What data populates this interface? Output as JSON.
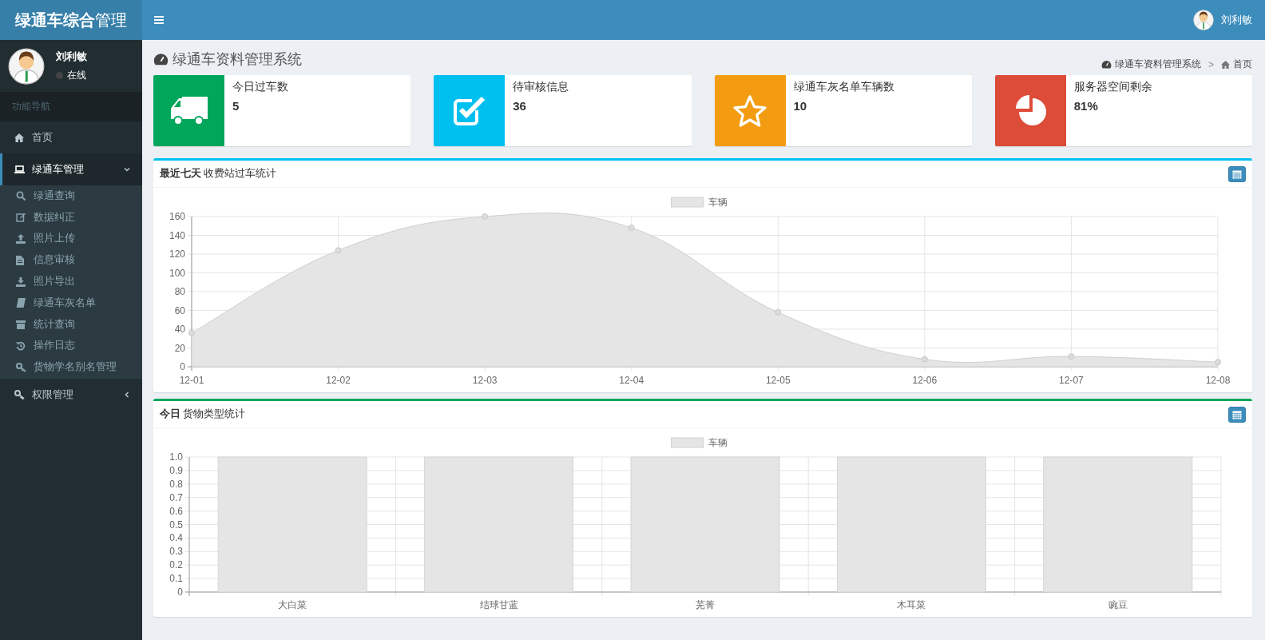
{
  "header": {
    "logo": "**绿通车综合**管理",
    "user_name": "刘利敏"
  },
  "sidebar": {
    "user": {
      "name": "刘利敏",
      "status": "在线",
      "online": false
    },
    "nav_header": "功能导航",
    "items": [
      {
        "label": "首页",
        "selected": false
      },
      {
        "label": "绿通车管理",
        "selected": true,
        "expanded": true,
        "children": [
          {
            "label": "绿通查询"
          },
          {
            "label": "数据纠正"
          },
          {
            "label": "照片上传"
          },
          {
            "label": "信息审核"
          },
          {
            "label": "照片导出"
          },
          {
            "label": "绿通车灰名单"
          },
          {
            "label": "统计查询"
          },
          {
            "label": "操作日志"
          },
          {
            "label": "货物学名别名管理"
          }
        ]
      },
      {
        "label": "权限管理",
        "selected": false,
        "expanded": false
      }
    ]
  },
  "page_title": "绿通车资料管理系统",
  "breadcrumb": {
    "items": [
      "绿通车资料管理系统",
      "首页"
    ],
    "separator": ">"
  },
  "info_boxes": [
    {
      "label": "今日过车数",
      "value": "5",
      "color": "#00a65a"
    },
    {
      "label": "待审核信息",
      "value": "36",
      "color": "#00c0ef"
    },
    {
      "label": "绿通车灰名单车辆数",
      "value": "10",
      "color": "#f39c12"
    },
    {
      "label": "服务器空间剩余",
      "value": "81%",
      "color": "#dd4b39"
    }
  ],
  "boxes": [
    {
      "title": "**最近七天** 收费站过车统计",
      "color": "#00c0ef",
      "chart_data": {
        "type": "area",
        "categories": [
          "12-01",
          "12-02",
          "12-03",
          "12-04",
          "12-05",
          "12-06",
          "12-07",
          "12-08"
        ],
        "series": [
          {
            "name": "车辆",
            "color": "#e5e5e5",
            "values": [
              36,
              124,
              160,
              148,
              58,
              8,
              11,
              5
            ]
          }
        ],
        "ylim": [
          0,
          160
        ],
        "grid": true,
        "yticks": [
          0,
          20,
          40,
          60,
          80,
          100,
          120,
          140,
          160
        ]
      }
    },
    {
      "title": "**今日** 货物类型统计",
      "color": "#00a65a",
      "chart_data": {
        "type": "bar",
        "categories": [
          "大白菜",
          "结球甘蓝",
          "芜菁",
          "木耳菜",
          "豌豆"
        ],
        "series": [
          {
            "name": "车辆",
            "color": "#e5e5e5",
            "values": [
              1,
              1,
              1,
              1,
              1
            ]
          }
        ],
        "ylim": [
          0,
          1
        ],
        "grid": true,
        "yticks": [
          0,
          0.1,
          0.2,
          0.3,
          0.4,
          0.5,
          0.6,
          0.7,
          0.8,
          0.9,
          {
            "value": 1,
            "label": "1.0"
          }
        ]
      }
    }
  ]
}
